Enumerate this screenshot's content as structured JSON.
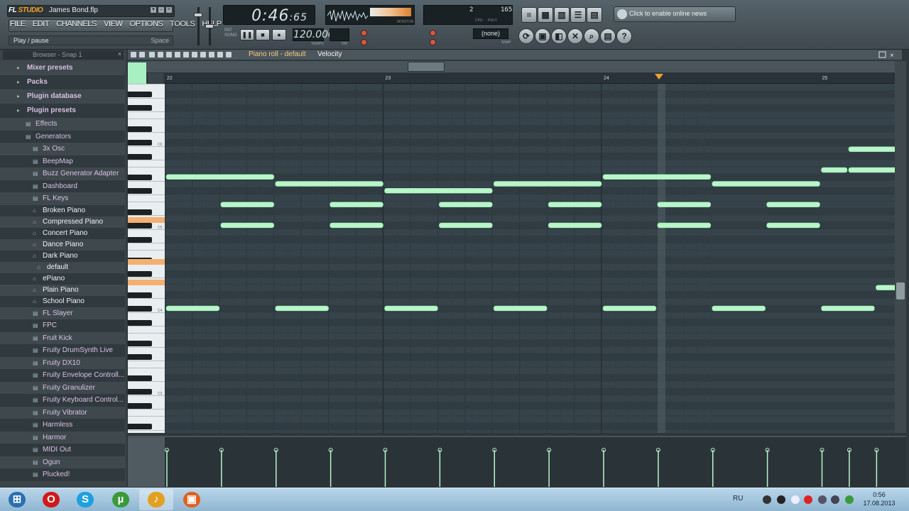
{
  "app": {
    "logo_prefix": "FL",
    "logo_suffix": "STUDIO",
    "project": "James Bond.flp"
  },
  "menu": [
    "FILE",
    "EDIT",
    "CHANNELS",
    "VIEW",
    "OPTIONS",
    "TOOLS",
    "HELP"
  ],
  "hint": {
    "left": "Play / pause",
    "right": "Space"
  },
  "transport": {
    "time_main": "0:46",
    "time_sub": ":65",
    "mode_labels": [
      "PAT",
      "SONG"
    ],
    "tempo": "120.000",
    "tempo_label": "TEMPO",
    "pat_label": "PAT",
    "pause_icon": "❚❚",
    "stop_icon": "■",
    "record_icon": "●"
  },
  "monitor": {
    "label": "MONITOR",
    "cpu": "2",
    "polys": "165",
    "cpu_label": "CPU",
    "poly_label": "POLY"
  },
  "snap": {
    "value": "(none)",
    "label": "SNAP"
  },
  "news": {
    "text": "Click to enable online news"
  },
  "browser": {
    "title": "Browser - Snap 1",
    "items": [
      {
        "label": "Mixer presets",
        "kind": "top",
        "indent": 0
      },
      {
        "label": "Packs",
        "kind": "top",
        "indent": 0
      },
      {
        "label": "Plugin database",
        "kind": "top",
        "indent": 0
      },
      {
        "label": "Plugin presets",
        "kind": "top",
        "indent": 0
      },
      {
        "label": "Effects",
        "kind": "folder",
        "indent": 1
      },
      {
        "label": "Generators",
        "kind": "folder",
        "indent": 1
      },
      {
        "label": "3x Osc",
        "kind": "gen",
        "indent": 2
      },
      {
        "label": "BeepMap",
        "kind": "gen",
        "indent": 2
      },
      {
        "label": "Buzz Generator Adapter",
        "kind": "gen",
        "indent": 2
      },
      {
        "label": "Dashboard",
        "kind": "gen",
        "indent": 2
      },
      {
        "label": "FL Keys",
        "kind": "gen",
        "indent": 2
      },
      {
        "label": "Broken Piano",
        "kind": "leaf",
        "indent": 3
      },
      {
        "label": "Compressed Piano",
        "kind": "leaf",
        "indent": 3
      },
      {
        "label": "Concert Piano",
        "kind": "leaf",
        "indent": 3
      },
      {
        "label": "Dance Piano",
        "kind": "leaf",
        "indent": 3
      },
      {
        "label": "Dark Piano",
        "kind": "leaf",
        "indent": 3
      },
      {
        "label": "default",
        "kind": "sel",
        "indent": 4
      },
      {
        "label": "ePiano",
        "kind": "leaf",
        "indent": 3
      },
      {
        "label": "Plain Piano",
        "kind": "leaf",
        "indent": 3
      },
      {
        "label": "School Piano",
        "kind": "leaf",
        "indent": 3
      },
      {
        "label": "FL Slayer",
        "kind": "gen",
        "indent": 2
      },
      {
        "label": "FPC",
        "kind": "gen",
        "indent": 2
      },
      {
        "label": "Fruit Kick",
        "kind": "gen",
        "indent": 2
      },
      {
        "label": "Fruity DrumSynth Live",
        "kind": "gen",
        "indent": 2
      },
      {
        "label": "Fruity DX10",
        "kind": "gen",
        "indent": 2
      },
      {
        "label": "Fruity Envelope Controll...",
        "kind": "gen",
        "indent": 2
      },
      {
        "label": "Fruity Granulizer",
        "kind": "gen",
        "indent": 2
      },
      {
        "label": "Fruity Keyboard Control...",
        "kind": "gen",
        "indent": 2
      },
      {
        "label": "Fruity Vibrator",
        "kind": "gen",
        "indent": 2
      },
      {
        "label": "Harmless",
        "kind": "gen",
        "indent": 2
      },
      {
        "label": "Harmor",
        "kind": "gen",
        "indent": 2
      },
      {
        "label": "MIDI Out",
        "kind": "gen",
        "indent": 2
      },
      {
        "label": "Ogun",
        "kind": "gen",
        "indent": 2
      },
      {
        "label": "Plucked!",
        "kind": "gen",
        "indent": 2
      }
    ]
  },
  "piano_roll": {
    "title": "Piano roll - default",
    "mode": "Velocity",
    "bars": [
      "22",
      "23",
      "24",
      "25"
    ],
    "key_labels": [
      "C6",
      "C5",
      "C4",
      "C3"
    ],
    "colors": {
      "note": "#b9f5c9",
      "note_border": "#7ddca0",
      "grid_bg": "#36434a",
      "row_dark": "#303c42",
      "velocity": "#b9f5c9"
    },
    "notes": [
      {
        "start": 0,
        "len": 1,
        "row": 13
      },
      {
        "start": 1,
        "len": 1,
        "row": 14
      },
      {
        "start": 2,
        "len": 1,
        "row": 15
      },
      {
        "start": 3,
        "len": 1,
        "row": 14
      },
      {
        "start": 4,
        "len": 1,
        "row": 13
      },
      {
        "start": 5,
        "len": 1,
        "row": 14
      },
      {
        "start": 0.5,
        "len": 0.5,
        "row": 17
      },
      {
        "start": 1.5,
        "len": 0.5,
        "row": 17
      },
      {
        "start": 2.5,
        "len": 0.5,
        "row": 17
      },
      {
        "start": 3.5,
        "len": 0.5,
        "row": 17
      },
      {
        "start": 4.5,
        "len": 0.5,
        "row": 17
      },
      {
        "start": 5.5,
        "len": 0.5,
        "row": 17
      },
      {
        "start": 0.5,
        "len": 0.5,
        "row": 20
      },
      {
        "start": 1.5,
        "len": 0.5,
        "row": 20
      },
      {
        "start": 2.5,
        "len": 0.5,
        "row": 20
      },
      {
        "start": 3.5,
        "len": 0.5,
        "row": 20
      },
      {
        "start": 4.5,
        "len": 0.5,
        "row": 20
      },
      {
        "start": 5.5,
        "len": 0.5,
        "row": 20
      },
      {
        "start": 0,
        "len": 0.5,
        "row": 32
      },
      {
        "start": 1,
        "len": 0.5,
        "row": 32
      },
      {
        "start": 2,
        "len": 0.5,
        "row": 32
      },
      {
        "start": 3,
        "len": 0.5,
        "row": 32
      },
      {
        "start": 4,
        "len": 0.5,
        "row": 32
      },
      {
        "start": 5,
        "len": 0.5,
        "row": 32
      },
      {
        "start": 6,
        "len": 0.5,
        "row": 32
      },
      {
        "start": 6,
        "len": 0.25,
        "row": 12
      },
      {
        "start": 6.25,
        "len": 0.45,
        "row": 12
      },
      {
        "start": 6.25,
        "len": 0.45,
        "row": 9
      },
      {
        "start": 6.5,
        "len": 0.2,
        "row": 29
      }
    ],
    "velocity_ticks": [
      0,
      0.5,
      1,
      1.5,
      2,
      2.5,
      3,
      3.5,
      4,
      4.5,
      5,
      5.5,
      6,
      6.25,
      6.5
    ]
  },
  "taskbar": {
    "apps": [
      {
        "name": "start",
        "color": "#2a6fb0",
        "glyph": "⊞"
      },
      {
        "name": "opera",
        "color": "#d01a1a",
        "glyph": "O"
      },
      {
        "name": "skype",
        "color": "#1ea0e0",
        "glyph": "S"
      },
      {
        "name": "utorrent",
        "color": "#3a9a3a",
        "glyph": "µ"
      },
      {
        "name": "fl-studio",
        "color": "#e2a020",
        "glyph": "♪"
      },
      {
        "name": "paint",
        "color": "#e06020",
        "glyph": "▣"
      }
    ],
    "lang": "RU",
    "time": "0:56",
    "date": "17.08.2013"
  }
}
